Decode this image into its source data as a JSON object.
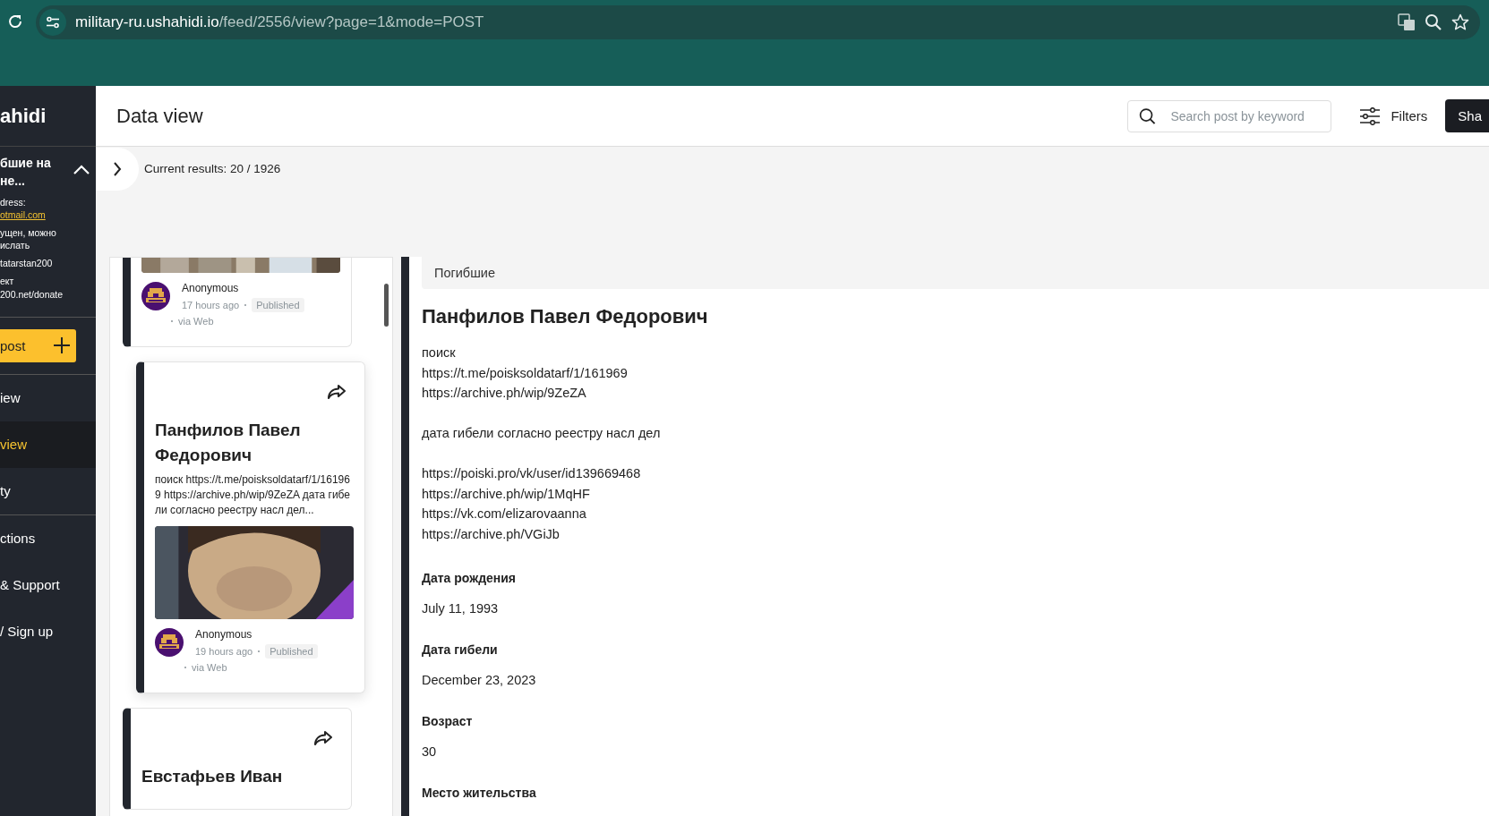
{
  "browser": {
    "url_host": "military-ru.ushahidi.io",
    "url_path": "/feed/2556/view?page=1&mode=POST"
  },
  "sidebar": {
    "logo": "ahidi",
    "survey_title": "бшие на\nне...",
    "info": [
      {
        "kind": "text",
        "text": "dress:"
      },
      {
        "kind": "link",
        "text": "otmail.com"
      },
      {
        "kind": "text",
        "text": "ущен, можно\nислать"
      },
      {
        "kind": "text",
        "text": "tatarstan200"
      },
      {
        "kind": "text",
        "text": "ект\n200.net/donate"
      }
    ],
    "post_button": "post",
    "nav_groups": [
      [
        {
          "label": "iew",
          "selected": false
        },
        {
          "label": "view",
          "selected": true
        },
        {
          "label": "ty",
          "selected": false
        }
      ],
      [
        {
          "label": "ctions",
          "selected": false
        },
        {
          "label": "& Support",
          "selected": false
        },
        {
          "label": "/ Sign up",
          "selected": false
        }
      ]
    ]
  },
  "header": {
    "title": "Data view",
    "search": {
      "placeholder": "Search post by keyword"
    },
    "filters": "Filters",
    "share_button": "Sha"
  },
  "results": "Current results: 20 / 1926",
  "posts": [
    {
      "selected": false,
      "author": "Anonymous",
      "time": "17 hours ago",
      "status": "Published",
      "source": "via Web"
    },
    {
      "selected": true,
      "title": "Панфилов Павел Федорович",
      "excerpt": "поиск https://t.me/poisksoldatarf/1/161969 https://archive.ph/wip/9ZeZA дата гибели согласно реестру насл дел...",
      "author": "Anonymous",
      "time": "19 hours ago",
      "status": "Published",
      "source": "via Web"
    },
    {
      "selected": false,
      "title": "Евстафьев Иван"
    }
  ],
  "detail": {
    "category": "Погибшие",
    "title": "Панфилов Павел Федорович",
    "description": "поиск\nhttps://t.me/poisksoldatarf/1/161969\nhttps://archive.ph/wip/9ZeZA\n\nдата гибели согласно реестру насл дел\n\nhttps://poiski.pro/vk/user/id139669468\nhttps://archive.ph/wip/1MqHF\nhttps://vk.com/elizarovaanna\nhttps://archive.ph/VGiJb",
    "fields": [
      {
        "label": "Дата рождения",
        "value": "July 11, 1993"
      },
      {
        "label": "Дата гибели",
        "value": "December 23, 2023"
      },
      {
        "label": "Возраст",
        "value": "30"
      },
      {
        "label": "Место жительства"
      }
    ]
  }
}
